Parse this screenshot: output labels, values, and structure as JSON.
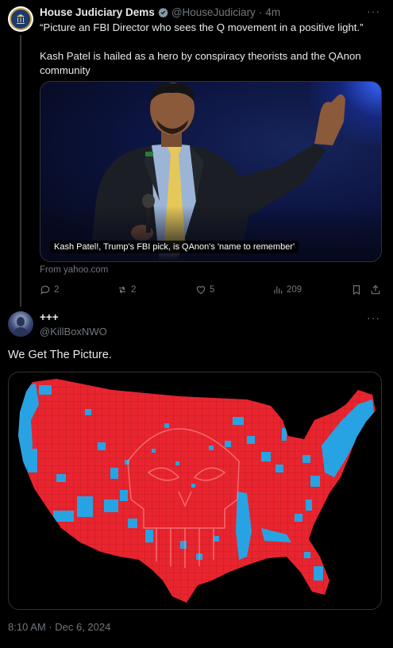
{
  "tweet1": {
    "display_name": "House Judiciary Dems",
    "handle": "@HouseJudiciary",
    "separator": "·",
    "time": "4m",
    "text_line1": "“Picture an FBI Director who sees the Q movement in a positive light.”",
    "text_line2": "Kash Patel is hailed as a hero by conspiracy theorists and the QAnon community",
    "card_caption": "Kash Patel!, Trump's FBI pick, is QAnon's 'name to remember'",
    "card_source": "From yahoo.com",
    "stats": {
      "replies": "2",
      "reposts": "2",
      "likes": "5",
      "views": "209"
    }
  },
  "tweet2": {
    "display_name": "+++",
    "handle": "@KillBoxNWO",
    "text": "We Get The Picture.",
    "timestamp": "8:10 AM · Dec 6, 2024"
  },
  "colors": {
    "background": "#000000",
    "text": "#e7e9ea",
    "muted": "#71767b",
    "verified": "#829aab",
    "map_red": "#e8252f",
    "map_blue": "#27a3e3"
  },
  "icons": {
    "verified": "verified-badge-icon",
    "more": "more-dots-icon",
    "reply": "reply-icon",
    "repost": "repost-icon",
    "like": "heart-icon",
    "views": "views-icon",
    "bookmark": "bookmark-icon",
    "share": "share-icon"
  }
}
